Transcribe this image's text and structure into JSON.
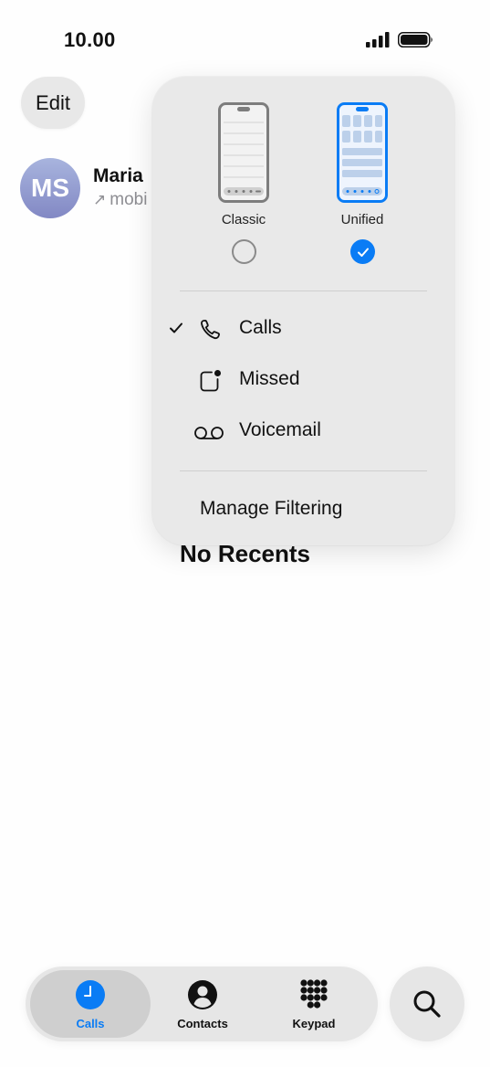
{
  "status_bar": {
    "time": "10.00"
  },
  "header": {
    "edit_label": "Edit"
  },
  "recent": {
    "avatar_initials": "MS",
    "name": "Maria",
    "subtitle": "mobi"
  },
  "empty_state": {
    "title": "No Recents"
  },
  "popover": {
    "layouts": [
      {
        "label": "Classic",
        "selected": false
      },
      {
        "label": "Unified",
        "selected": true
      }
    ],
    "filters": [
      {
        "label": "Calls",
        "icon": "phone-icon",
        "checked": true
      },
      {
        "label": "Missed",
        "icon": "missed-badge-icon",
        "checked": false
      },
      {
        "label": "Voicemail",
        "icon": "voicemail-icon",
        "checked": false
      }
    ],
    "manage_label": "Manage Filtering"
  },
  "tabs": [
    {
      "label": "Calls",
      "icon": "clock-icon",
      "selected": true
    },
    {
      "label": "Contacts",
      "icon": "person-icon",
      "selected": false
    },
    {
      "label": "Keypad",
      "icon": "keypad-icon",
      "selected": false
    }
  ],
  "colors": {
    "accent": "#0a7cf5",
    "popover_bg": "#e9e9e9",
    "tab_bar_bg": "#e6e6e6",
    "secondary_text": "#8e8e93"
  }
}
